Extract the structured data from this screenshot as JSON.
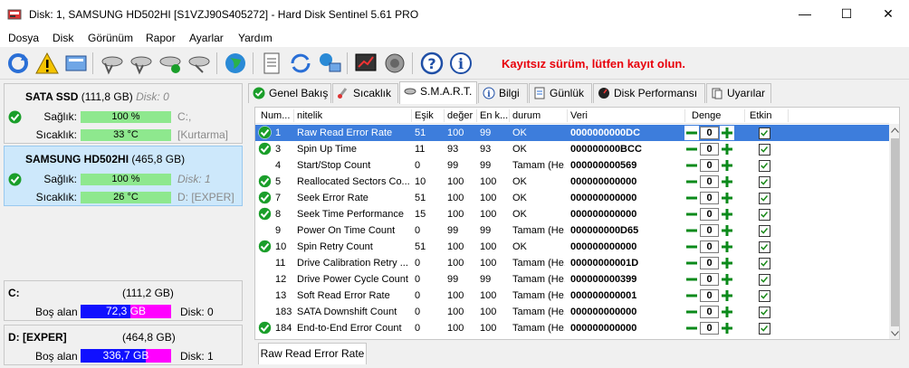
{
  "window": {
    "title": "Disk: 1, SAMSUNG HD502HI [S1VZJ90S405272]  -  Hard Disk Sentinel 5.61 PRO",
    "controls": {
      "minimize": "—",
      "maximize": "☐",
      "close": "✕"
    }
  },
  "menu": [
    "Dosya",
    "Disk",
    "Görünüm",
    "Rapor",
    "Ayarlar",
    "Yardım"
  ],
  "toolbar": {
    "unregistered_text": "Kayıtsız sürüm, lütfen kayıt olun."
  },
  "disks": [
    {
      "name": "SATA SSD",
      "size": "(111,8 GB)",
      "disk_label": "Disk: 0",
      "health_label": "Sağlık:",
      "health_value": "100 %",
      "health_fraction": 1.0,
      "temp_label": "Sıcaklık:",
      "temp_value": "33 °C",
      "volume": "C:,",
      "volume2": "[Kurtarma]",
      "selected": false
    },
    {
      "name": "SAMSUNG HD502HI",
      "size": "(465,8 GB)",
      "disk_label": "Disk: 1",
      "health_label": "Sağlık:",
      "health_value": "100 %",
      "health_fraction": 1.0,
      "temp_label": "Sıcaklık:",
      "temp_value": "26 °C",
      "volume": "D: [EXPER]",
      "selected": true
    }
  ],
  "drives": [
    {
      "name": "C:",
      "size": "(111,2 GB)",
      "free_label": "Boş alan",
      "free_value": "72,3 GB",
      "disk": "Disk: 0"
    },
    {
      "name": "D: [EXPER]",
      "size": "(464,8 GB)",
      "free_label": "Boş alan",
      "free_value": "336,7 GB",
      "disk": "Disk: 1"
    }
  ],
  "tabs": [
    "Genel Bakış",
    "Sıcaklık",
    "S.M.A.R.T.",
    "Bilgi",
    "Günlük",
    "Disk Performansı",
    "Uyarılar"
  ],
  "smart": {
    "columns": [
      "Num...",
      "nitelik",
      "Eşik",
      "değer",
      "En k...",
      "durum",
      "Veri",
      "Denge",
      "Etkin"
    ],
    "rows": [
      {
        "icon": true,
        "num": "1",
        "name": "Raw Read Error Rate",
        "thr": "51",
        "val": "100",
        "worst": "99",
        "status": "OK",
        "data": "0000000000DC",
        "bal": "0"
      },
      {
        "icon": true,
        "num": "3",
        "name": "Spin Up Time",
        "thr": "11",
        "val": "93",
        "worst": "93",
        "status": "OK",
        "data": "000000000BCC",
        "bal": "0"
      },
      {
        "icon": false,
        "num": "4",
        "name": "Start/Stop Count",
        "thr": "0",
        "val": "99",
        "worst": "99",
        "status": "Tamam (He...",
        "data": "000000000569",
        "bal": "0"
      },
      {
        "icon": true,
        "num": "5",
        "name": "Reallocated Sectors Co...",
        "thr": "10",
        "val": "100",
        "worst": "100",
        "status": "OK",
        "data": "000000000000",
        "bal": "0"
      },
      {
        "icon": true,
        "num": "7",
        "name": "Seek Error Rate",
        "thr": "51",
        "val": "100",
        "worst": "100",
        "status": "OK",
        "data": "000000000000",
        "bal": "0"
      },
      {
        "icon": true,
        "num": "8",
        "name": "Seek Time Performance",
        "thr": "15",
        "val": "100",
        "worst": "100",
        "status": "OK",
        "data": "000000000000",
        "bal": "0"
      },
      {
        "icon": false,
        "num": "9",
        "name": "Power On Time Count",
        "thr": "0",
        "val": "99",
        "worst": "99",
        "status": "Tamam (He...",
        "data": "000000000D65",
        "bal": "0"
      },
      {
        "icon": true,
        "num": "10",
        "name": "Spin Retry Count",
        "thr": "51",
        "val": "100",
        "worst": "100",
        "status": "OK",
        "data": "000000000000",
        "bal": "0"
      },
      {
        "icon": false,
        "num": "11",
        "name": "Drive Calibration Retry ...",
        "thr": "0",
        "val": "100",
        "worst": "100",
        "status": "Tamam (He...",
        "data": "00000000001D",
        "bal": "0"
      },
      {
        "icon": false,
        "num": "12",
        "name": "Drive Power Cycle Count",
        "thr": "0",
        "val": "99",
        "worst": "99",
        "status": "Tamam (He...",
        "data": "000000000399",
        "bal": "0"
      },
      {
        "icon": false,
        "num": "13",
        "name": "Soft Read Error Rate",
        "thr": "0",
        "val": "100",
        "worst": "100",
        "status": "Tamam (He...",
        "data": "000000000001",
        "bal": "0"
      },
      {
        "icon": false,
        "num": "183",
        "name": "SATA Downshift Count",
        "thr": "0",
        "val": "100",
        "worst": "100",
        "status": "Tamam (He...",
        "data": "000000000000",
        "bal": "0"
      },
      {
        "icon": true,
        "num": "184",
        "name": "End-to-End Error Count",
        "thr": "0",
        "val": "100",
        "worst": "100",
        "status": "Tamam (He...",
        "data": "000000000000",
        "bal": "0"
      }
    ]
  },
  "bottom_tab": "Raw Read Error Rate",
  "colors": {
    "ok_green": "#1a9e2a",
    "selection": "#3d7ddc",
    "health_bar": "#8ee88e",
    "unregistered": "#e8000b"
  }
}
